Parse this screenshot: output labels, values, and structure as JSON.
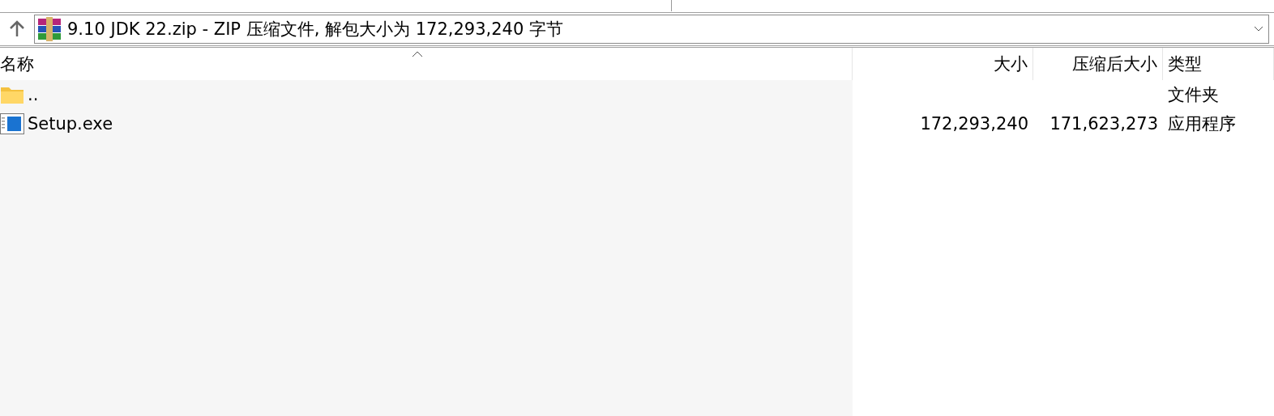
{
  "address_bar": {
    "path": "9.10 JDK 22.zip - ZIP 压缩文件, 解包大小为 172,293,240 字节"
  },
  "table": {
    "columns": [
      {
        "label": "名称",
        "sorted": true
      },
      {
        "label": "大小",
        "sorted": false
      },
      {
        "label": "压缩后大小",
        "sorted": false
      },
      {
        "label": "类型",
        "sorted": false
      }
    ],
    "rows": [
      {
        "kind": "folder",
        "name": "..",
        "size": "",
        "packed": "",
        "type": "文件夹"
      },
      {
        "kind": "exe",
        "name": "Setup.exe",
        "size": "172,293,240",
        "packed": "171,623,273",
        "type": "应用程序"
      }
    ]
  }
}
